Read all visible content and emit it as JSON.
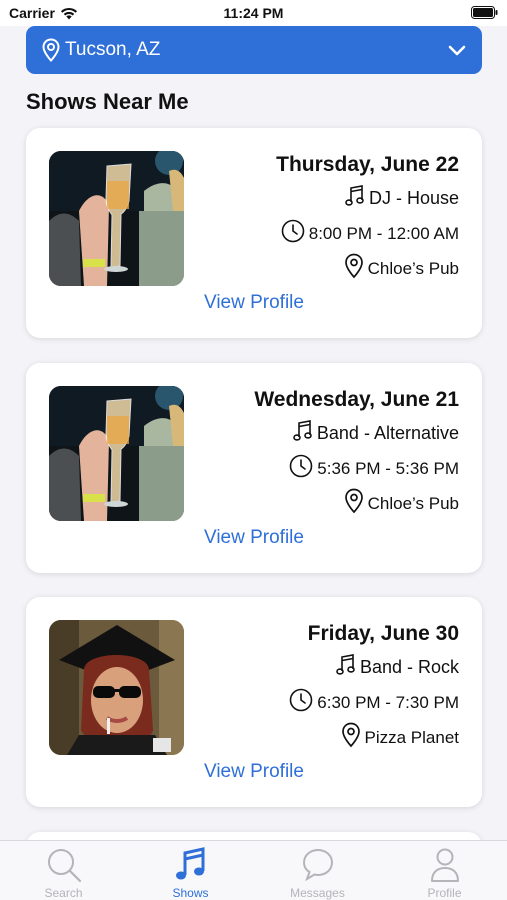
{
  "status_bar": {
    "carrier": "Carrier",
    "time": "11:24 PM"
  },
  "location": {
    "city": "Tucson, AZ",
    "icon": "map-pin-icon",
    "dropdown_icon": "chevron-down-icon"
  },
  "section_title": "Shows Near Me",
  "shows": [
    {
      "date": "Thursday, June 22",
      "genre": "DJ - House",
      "time": "8:00 PM - 12:00 AM",
      "venue": "Chloe’s Pub",
      "link": "View Profile",
      "image": "photo-champagne"
    },
    {
      "date": "Wednesday, June 21",
      "genre": "Band - Alternative",
      "time": "5:36 PM - 5:36 PM",
      "venue": "Chloe’s Pub",
      "link": "View Profile",
      "image": "photo-champagne"
    },
    {
      "date": "Friday, June 30",
      "genre": "Band - Rock",
      "time": "6:30 PM - 7:30 PM",
      "venue": "Pizza Planet",
      "link": "View Profile",
      "image": "photo-graduate"
    }
  ],
  "tabs": [
    {
      "label": "Search",
      "icon": "search-icon",
      "active": false
    },
    {
      "label": "Shows",
      "icon": "music-note-icon",
      "active": true
    },
    {
      "label": "Messages",
      "icon": "chat-bubble-icon",
      "active": false
    },
    {
      "label": "Profile",
      "icon": "person-icon",
      "active": false
    }
  ],
  "colors": {
    "accent": "#2e6fd8",
    "background": "#f3f3f8",
    "tab_inactive": "#b4b4b9"
  }
}
